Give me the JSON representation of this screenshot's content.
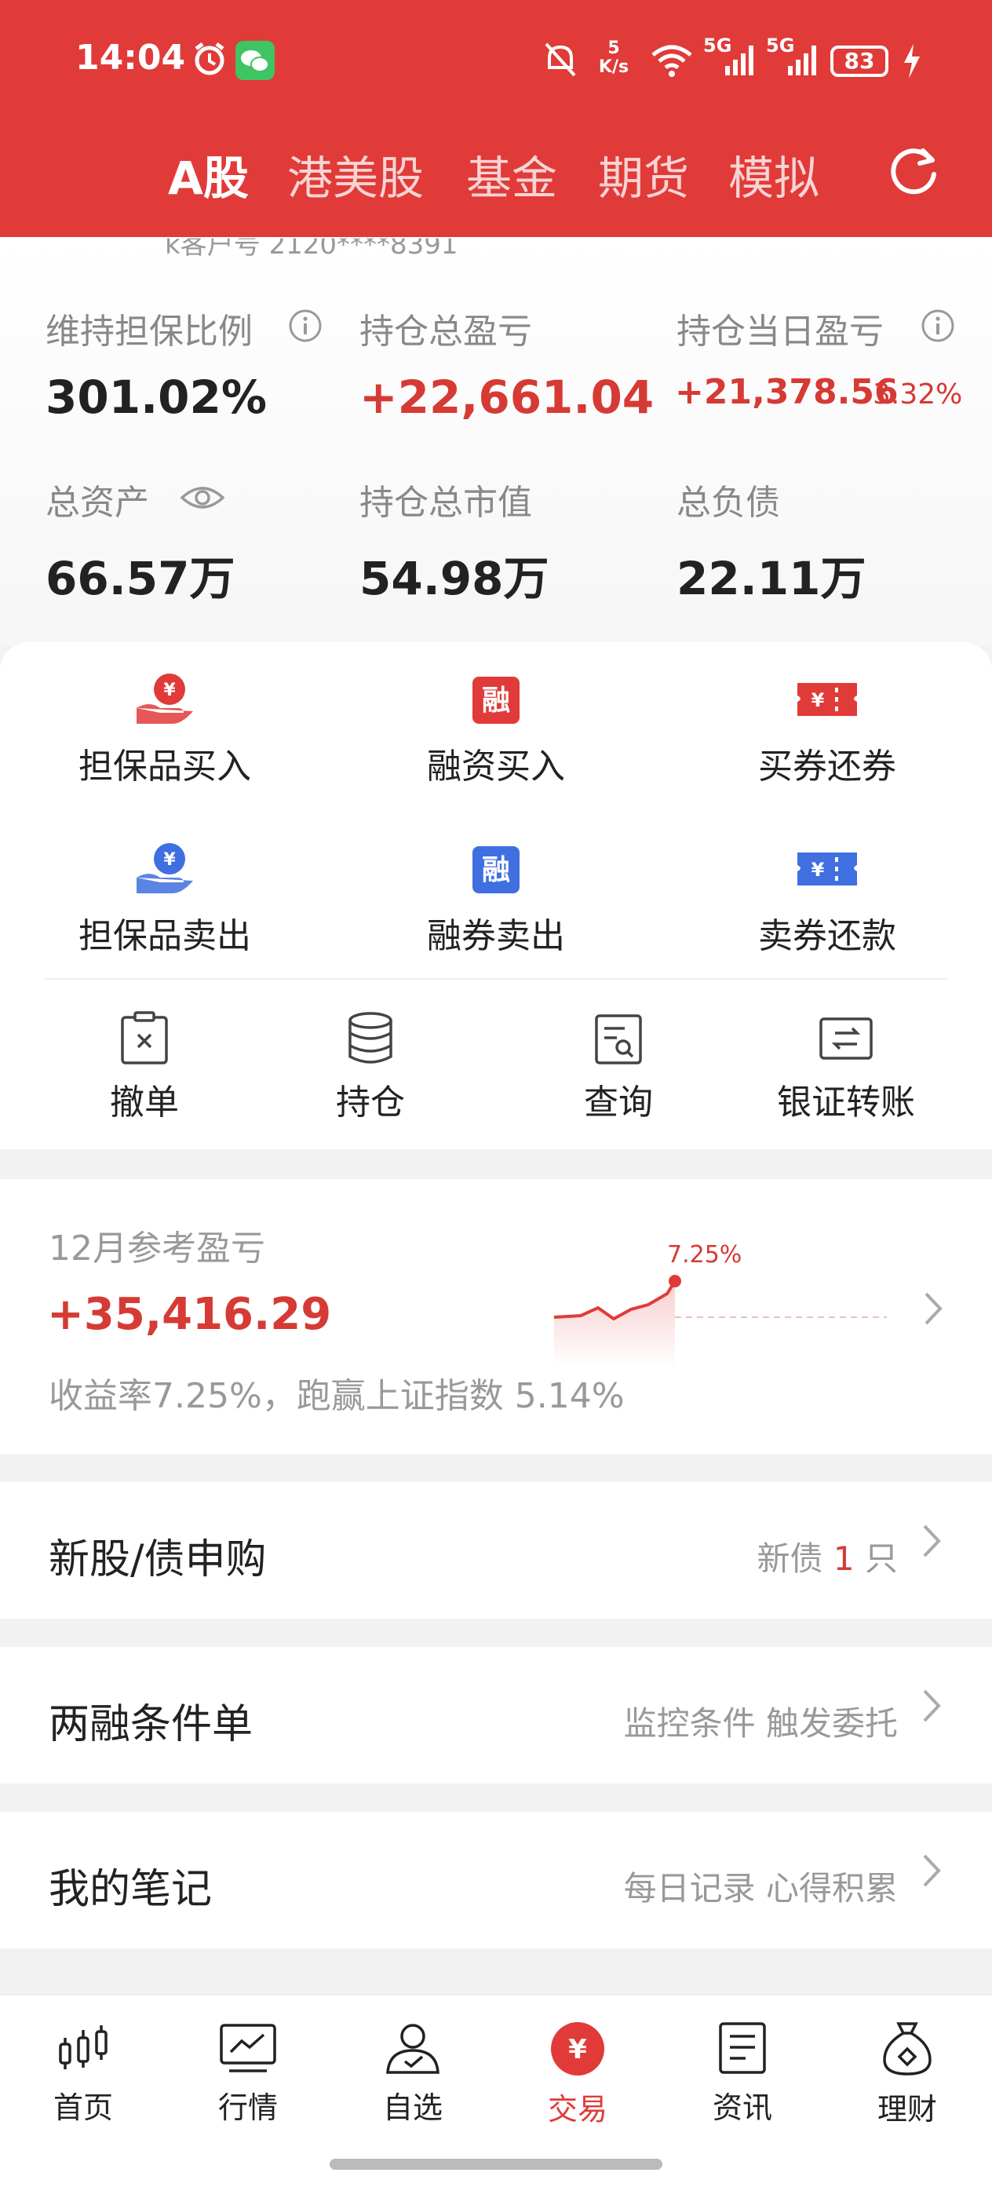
{
  "status_bar": {
    "time": "14:04",
    "net_speed_value": "5",
    "net_speed_unit": "K/s",
    "wifi_label": "6",
    "sim1": "5G",
    "sim2": "5G",
    "battery": "83"
  },
  "tabs": [
    {
      "label": "A股",
      "active": true
    },
    {
      "label": "港美股",
      "active": false
    },
    {
      "label": "基金",
      "active": false
    },
    {
      "label": "期货",
      "active": false
    },
    {
      "label": "模拟",
      "active": false
    }
  ],
  "account_partial": "k客户号 2120****8391",
  "metrics": {
    "maintenance_ratio_label": "维持担保比例",
    "maintenance_ratio_value": "301.02%",
    "total_pl_label": "持仓总盈亏",
    "total_pl_value": "+22,661.04",
    "daily_pl_label": "持仓当日盈亏",
    "daily_pl_value": "+21,378.56",
    "daily_pl_pct": "3.32%",
    "total_assets_label": "总资产",
    "total_assets_value": "66.57万",
    "market_value_label": "持仓总市值",
    "market_value_value": "54.98万",
    "total_liability_label": "总负债",
    "total_liability_value": "22.11万"
  },
  "actions": {
    "row1": [
      "担保品买入",
      "融资买入",
      "买券还券"
    ],
    "row2": [
      "担保品卖出",
      "融券卖出",
      "卖券还款"
    ],
    "row3": [
      "撤单",
      "持仓",
      "查询",
      "银证转账"
    ],
    "icon_char_yuan": "¥",
    "icon_char_rong": "融"
  },
  "monthly_pl": {
    "title": "12月参考盈亏",
    "value": "+35,416.29",
    "subtitle": "收益率7.25%，跑赢上证指数 5.14%",
    "chart_label": "7.25%"
  },
  "rows": [
    {
      "title": "新股/债申购",
      "right_prefix": "新债 ",
      "right_highlight": "1",
      "right_suffix": " 只"
    },
    {
      "title": "两融条件单",
      "right": "监控条件 触发委托"
    },
    {
      "title": "我的笔记",
      "right": "每日记录 心得积累"
    }
  ],
  "bottom_nav": [
    {
      "label": "首页",
      "active": false
    },
    {
      "label": "行情",
      "active": false
    },
    {
      "label": "自选",
      "active": false
    },
    {
      "label": "交易",
      "active": true
    },
    {
      "label": "资讯",
      "active": false
    },
    {
      "label": "理财",
      "active": false
    }
  ],
  "colors": {
    "brand_red": "#e03b39",
    "profit_red": "#d63a34",
    "blue": "#3f6fe0"
  }
}
